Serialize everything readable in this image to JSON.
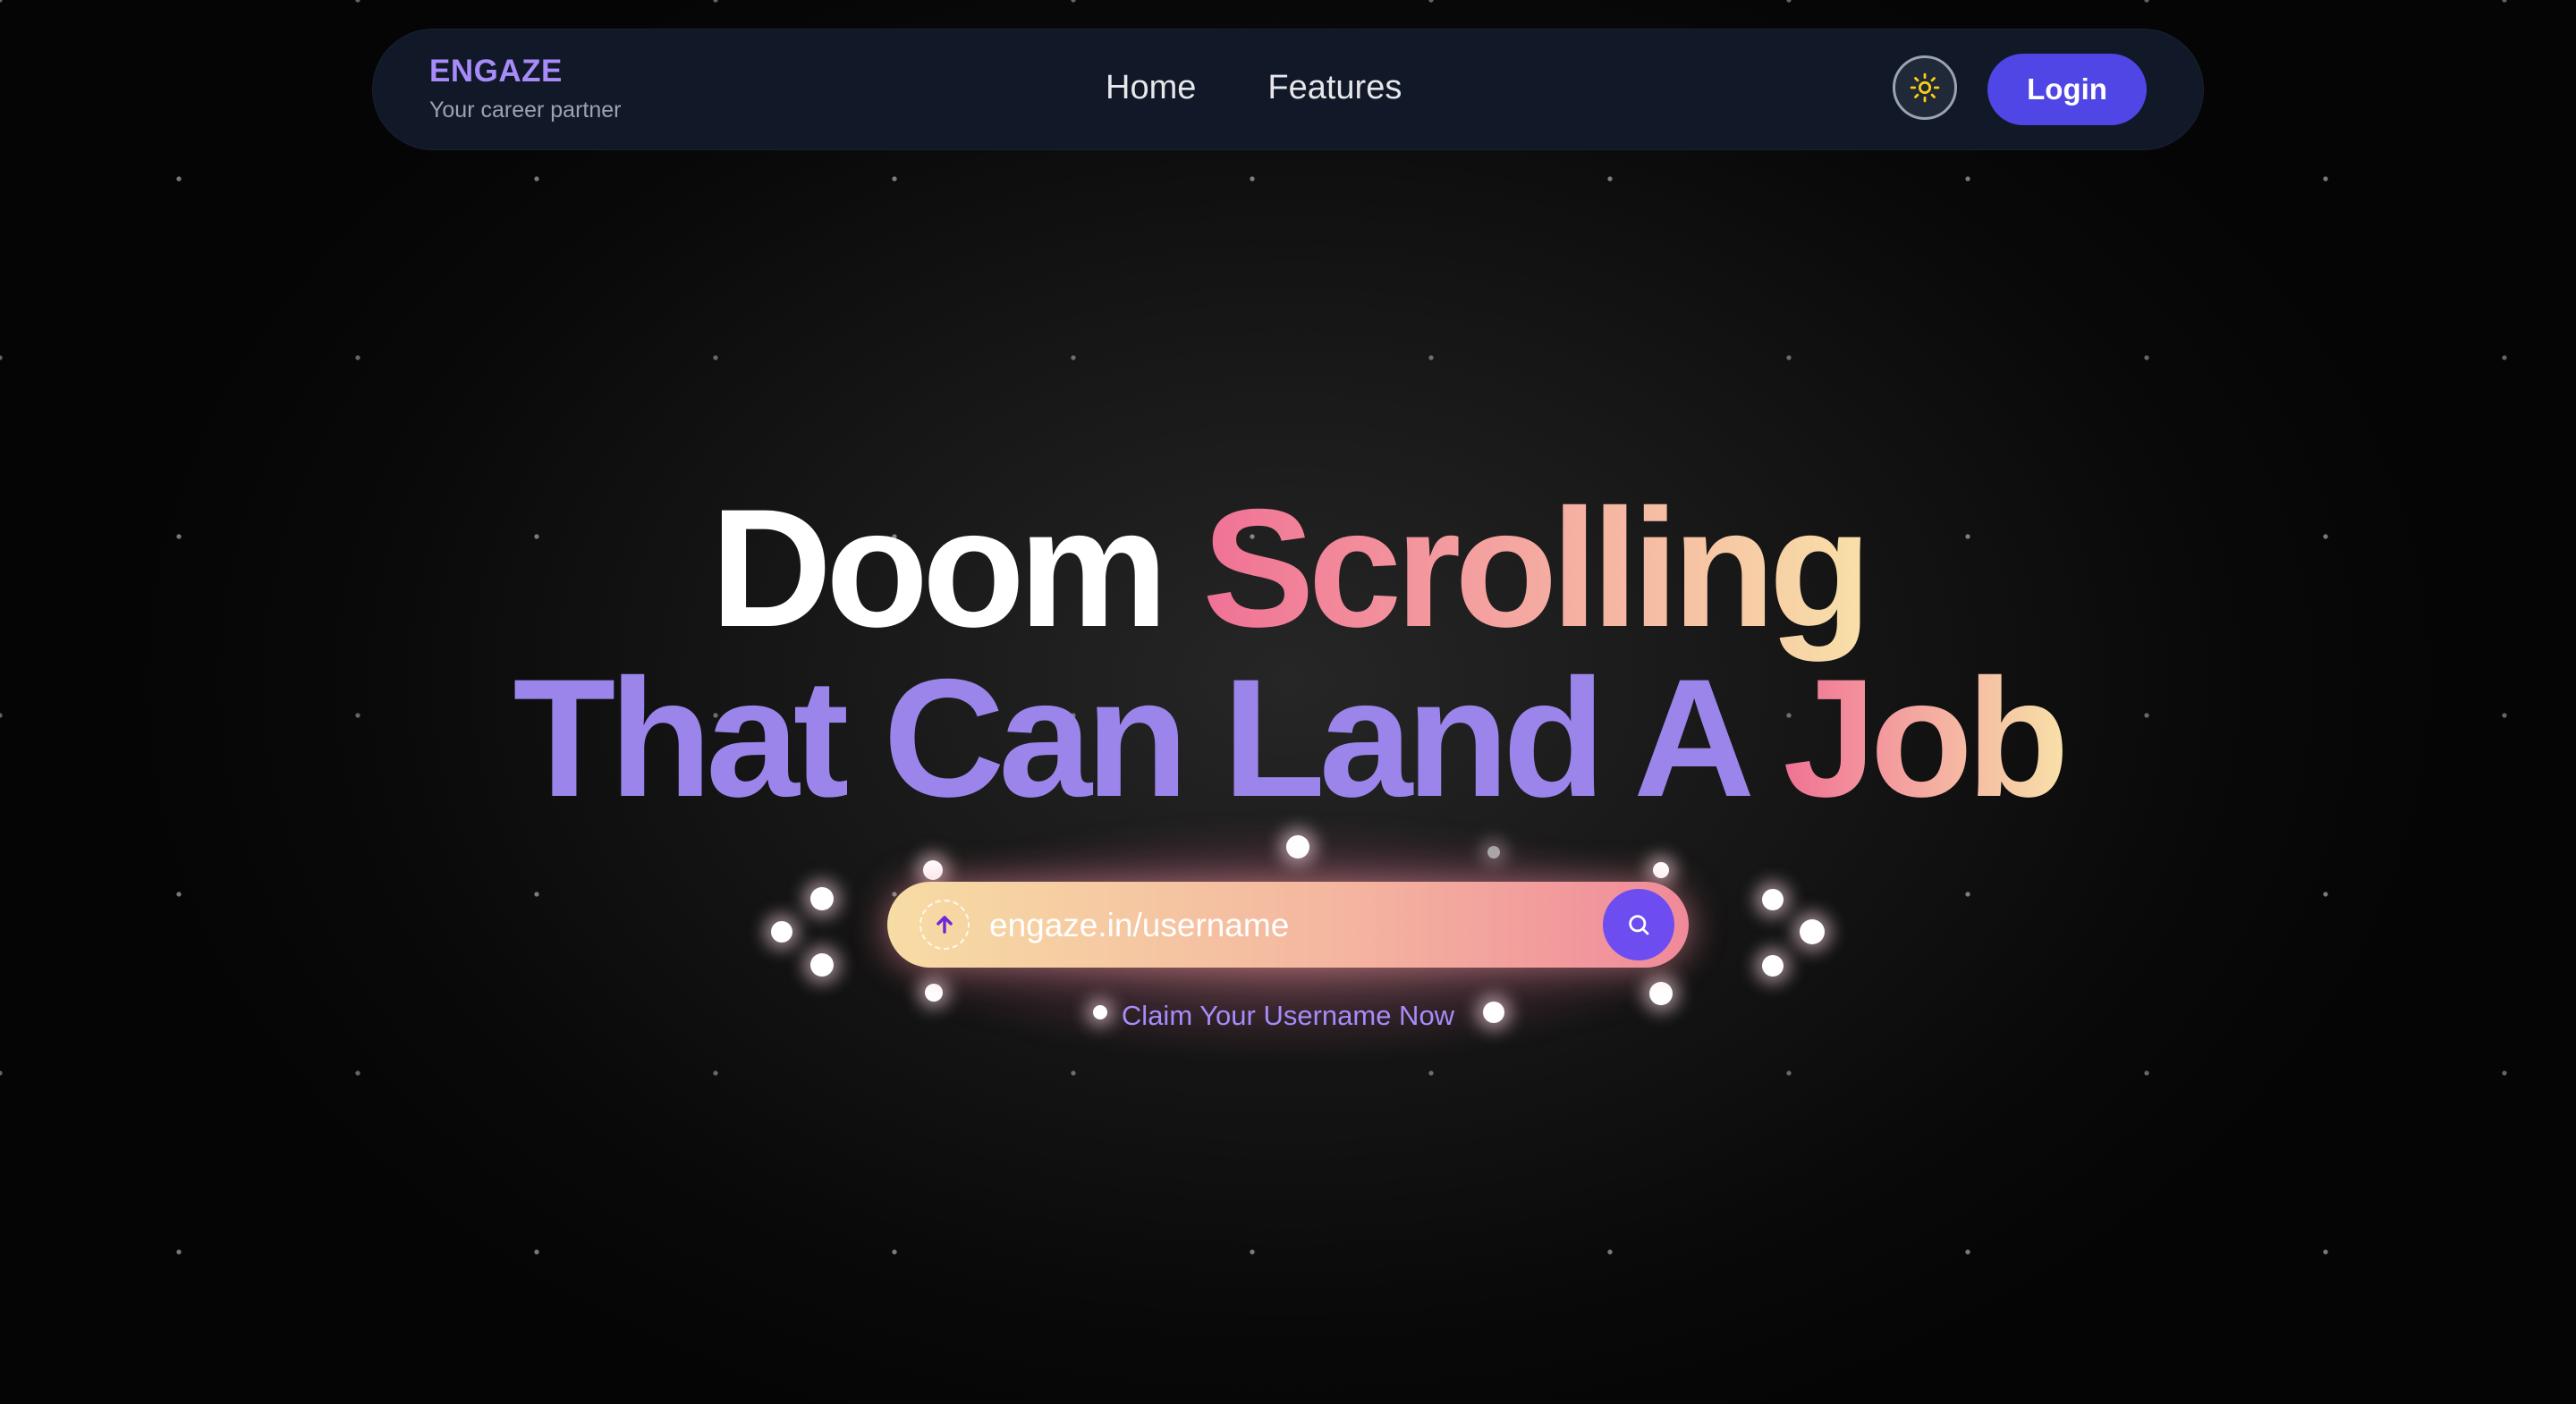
{
  "brand": {
    "name": "ENGAZE",
    "tagline": "Your career partner"
  },
  "nav": {
    "links": [
      "Home",
      "Features"
    ],
    "login_label": "Login",
    "theme_icon": "sun-icon"
  },
  "hero": {
    "line1": {
      "white": "Doom ",
      "gradient": "Scrolling"
    },
    "line2": {
      "purple": "That Can Land A ",
      "gradient": "Job"
    }
  },
  "search": {
    "placeholder": "engaze.in/username",
    "left_icon": "arrow-up-icon",
    "button_icon": "search-icon"
  },
  "claim_label": "Claim Your Username Now",
  "colors": {
    "background": "#0a0a0a",
    "navbar": "#111827",
    "brand": "#a78bfa",
    "login": "#4f46e5",
    "search_button": "#6d4cf0",
    "headline_purple": "#9b85ea",
    "gradient_start": "#f07195",
    "gradient_end": "#f8e0a8"
  }
}
